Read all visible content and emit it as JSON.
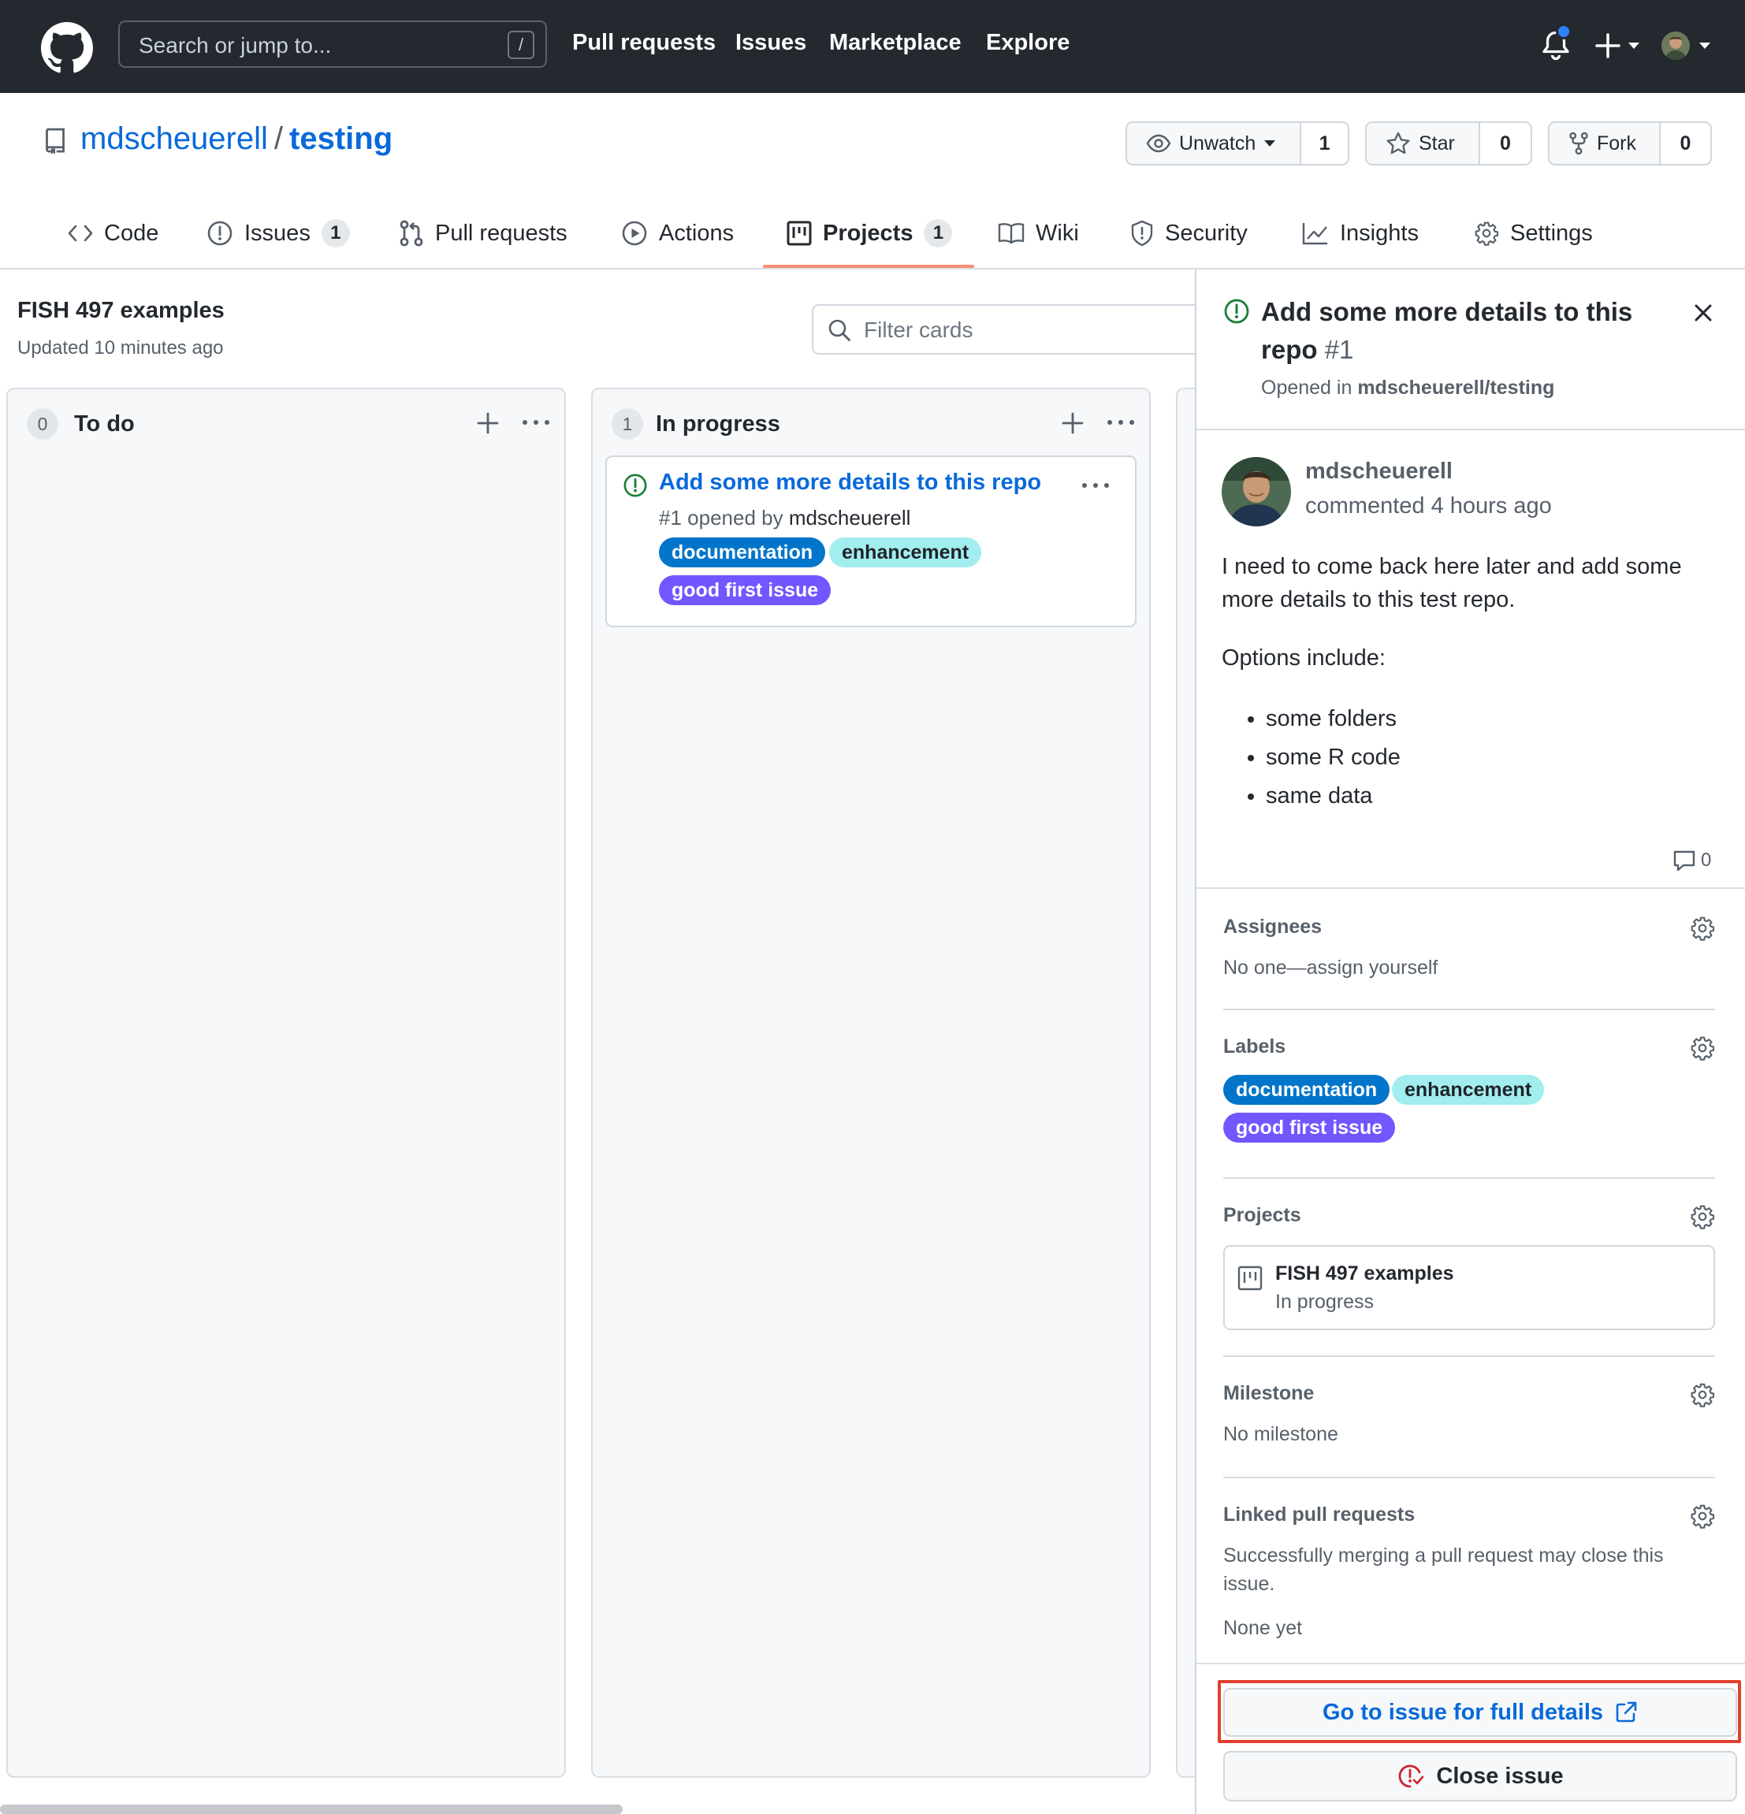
{
  "header": {
    "search_placeholder": "Search or jump to...",
    "search_shortcut": "/",
    "nav": [
      "Pull requests",
      "Issues",
      "Marketplace",
      "Explore"
    ]
  },
  "repo": {
    "owner": "mdscheuerell",
    "separator": "/",
    "name": "testing",
    "watch_label": "Unwatch",
    "watch_count": "1",
    "star_label": "Star",
    "star_count": "0",
    "fork_label": "Fork",
    "fork_count": "0"
  },
  "tabs": [
    {
      "label": "Code",
      "icon": "code-icon"
    },
    {
      "label": "Issues",
      "icon": "issue-opened-icon",
      "counter": "1"
    },
    {
      "label": "Pull requests",
      "icon": "git-pull-request-icon"
    },
    {
      "label": "Actions",
      "icon": "play-icon"
    },
    {
      "label": "Projects",
      "icon": "project-icon",
      "counter": "1",
      "selected": true
    },
    {
      "label": "Wiki",
      "icon": "book-icon"
    },
    {
      "label": "Security",
      "icon": "shield-icon"
    },
    {
      "label": "Insights",
      "icon": "graph-icon"
    },
    {
      "label": "Settings",
      "icon": "gear-icon"
    }
  ],
  "project": {
    "name": "FISH 497 examples",
    "updated": "Updated 10 minutes ago",
    "filter_placeholder": "Filter cards",
    "columns": [
      {
        "name": "To do",
        "count": "0"
      },
      {
        "name": "In progress",
        "count": "1"
      }
    ],
    "card": {
      "title": "Add some more details to this repo",
      "meta_prefix": "#1 opened by ",
      "author": "mdscheuerell",
      "labels": [
        "documentation",
        "enhancement",
        "good first issue"
      ]
    }
  },
  "pane": {
    "title": "Add some more details to this repo",
    "number": "#1",
    "opened_prefix": "Opened in ",
    "opened_repo": "mdscheuerell/testing",
    "comment_author": "mdscheuerell",
    "comment_when": "commented 4 hours ago",
    "body_p1": "I need to come back here later and add some more details to this test repo.",
    "body_p2": "Options include:",
    "body_list": [
      "some folders",
      "some R code",
      "same data"
    ],
    "comment_count": "0",
    "assignees_title": "Assignees",
    "assignees_value": "No one—assign yourself",
    "labels_title": "Labels",
    "labels": [
      "documentation",
      "enhancement",
      "good first issue"
    ],
    "projects_title": "Projects",
    "project_name": "FISH 497 examples",
    "project_column": "In progress",
    "milestone_title": "Milestone",
    "milestone_value": "No milestone",
    "linked_title": "Linked pull requests",
    "linked_desc_1": "Successfully merging a pull request may close this",
    "linked_desc_2": "issue.",
    "linked_value": "None yet",
    "full_details_button": "Go to issue for full details",
    "close_issue_button": "Close issue"
  },
  "colors": {
    "header_bg": "#24292f",
    "link": "#0969da",
    "open_issue": "#1a7f37",
    "tab_underline": "#fd8c73",
    "label_documentation": "#0075ca",
    "label_enhancement": "#a2eeef",
    "label_good_first_issue": "#7057ff",
    "highlight": "#e2402f",
    "close_issue_icon": "#cf222e"
  }
}
